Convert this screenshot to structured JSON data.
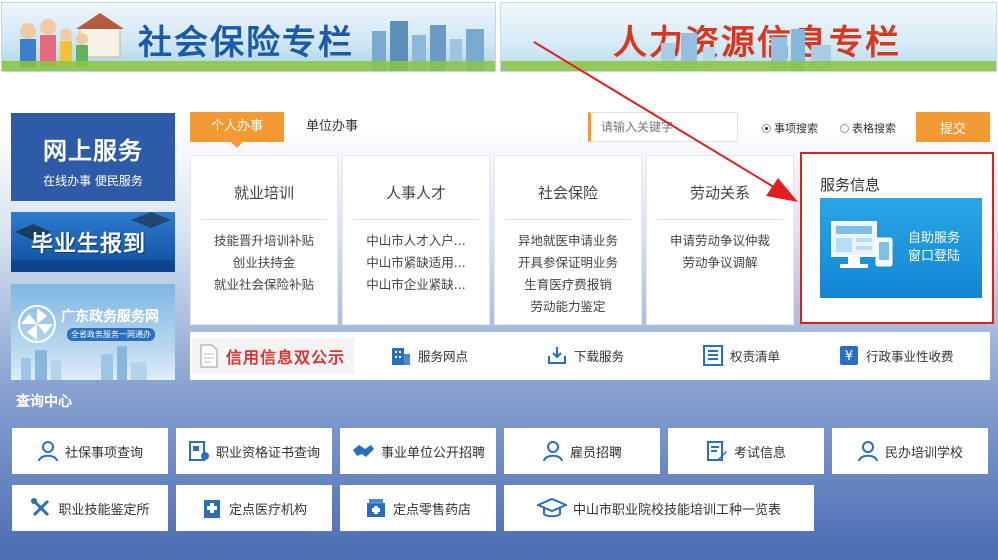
{
  "banners": {
    "social_insurance": "社会保险专栏",
    "human_resources": "人力资源信息专栏"
  },
  "left": {
    "online_title": "网上服务",
    "online_subtitle": "在线办事 便民服务",
    "graduate_banner": "毕业生报到",
    "gd_title": "广东政务服务网",
    "gd_subtitle": "全省政务服务一网通办"
  },
  "tabs": {
    "personal": "个人办事",
    "unit": "单位办事"
  },
  "search": {
    "placeholder": "请输入关键字",
    "radio_items": "事项搜索",
    "radio_forms": "表格搜索",
    "submit": "提交"
  },
  "categories": [
    {
      "title": "就业培训",
      "items": [
        "技能晋升培训补贴",
        "创业扶持金",
        "就业社会保险补贴"
      ]
    },
    {
      "title": "人事人才",
      "items": [
        "中山市人才入户...",
        "中山市紧缺适用...",
        "中山市企业紧缺..."
      ]
    },
    {
      "title": "社会保险",
      "items": [
        "异地就医申请业务",
        "开具参保证明业务",
        "生育医疗费报销",
        "劳动能力鉴定"
      ]
    },
    {
      "title": "劳动关系",
      "items": [
        "申请劳动争议仲裁",
        "劳动争议调解"
      ]
    }
  ],
  "service_info": {
    "title": "服务信息",
    "box_line1": "自助服务",
    "box_line2": "窗口登陆"
  },
  "credit_bar": {
    "logo_text": "信用信息双公示",
    "links": [
      "服务网点",
      "下载服务",
      "权责清单",
      "行政事业性收费"
    ]
  },
  "query": {
    "title": "查询中心",
    "buttons": [
      "社保事项查询",
      "职业资格证书查询",
      "事业单位公开招聘",
      "雇员招聘",
      "考试信息",
      "民办培训学校",
      "职业技能鉴定所",
      "定点医疗机构",
      "定点零售药店",
      "中山市职业院校技能培训工种一览表"
    ]
  },
  "colors": {
    "orange": "#f39a34",
    "navy": "#2e5ba8",
    "red_outline": "#e02020",
    "sky": "#1e96e0"
  }
}
